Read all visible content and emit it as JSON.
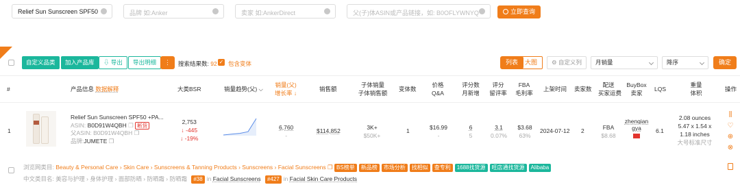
{
  "search": {
    "keyword": "Relief Sun Sunscreen SPF50",
    "brand_placeholder": "品牌 如:Anker",
    "seller_placeholder": "卖家 如:AnkerDirect",
    "asin_placeholder": "父(子)体ASIN或产品链接，如: B0OFLYWNYQ",
    "query_label": "立即查询"
  },
  "toolbar": {
    "custom_category": "自定义品类",
    "add_library": "加入产品库",
    "export": "导出",
    "export_detail": "导出明细",
    "more": "⋮",
    "result_prefix": "搜索结果数:",
    "result_count": "92",
    "include_variants": "包含变体",
    "view_list": "列表",
    "view_grid": "大图",
    "custom_columns": "自定义列",
    "sort_field": "月销量",
    "sort_order": "降序",
    "confirm": "确定"
  },
  "columns": {
    "index": "#",
    "product_info": "产品信息",
    "data_explain": "数据解释",
    "bsr": "大类BSR",
    "trend": "销量趋势(父)",
    "sales": "销量(父)",
    "growth": "增长率",
    "revenue": "销售额",
    "child_sales": "子体销量",
    "child_revenue": "子体销售额",
    "variants": "变体数",
    "price": "价格",
    "qa": "Q&A",
    "reviews": "评分数",
    "monthly_new": "月新增",
    "rating": "评分",
    "retention": "留评率",
    "fba": "FBA",
    "margin": "毛利率",
    "launch": "上架时间",
    "sellers": "卖家数",
    "delivery": "配送",
    "buybox_shipping": "买家运费",
    "buybox": "BuyBox",
    "buybox_seller": "卖家",
    "lqs": "LQS",
    "weight": "重量",
    "volume": "体积",
    "actions": "操作"
  },
  "row": {
    "index": "1",
    "title": "Relief Sun Sunscreen SPF50 +PA...",
    "asin_label": "ASIN:",
    "asin": "B0D91W4QBH",
    "badge": "断货",
    "parent_label": "父ASIN:",
    "parent_asin": "B0D91W4QBH",
    "brand_label": "品牌:",
    "brand": "JUMETE",
    "bsr": "2,753",
    "bsr_change": "↓ -445",
    "bsr_pct": "↓ -19%",
    "sales": "6,760",
    "sales_growth": "-",
    "revenue": "$114,852",
    "child_sales": "3K+",
    "child_revenue": "$50K+",
    "variants": "1",
    "price": "$16.99",
    "qa": "-",
    "reviews": "6",
    "monthly_new": "5",
    "rating": "3.1",
    "retention": "0.07%",
    "fba_fee": "$3.68",
    "margin": "63%",
    "launch": "2024-07-12",
    "sellers": "2",
    "delivery": "FBA",
    "shipping": "$8.68",
    "buybox_seller": "zhenqiangya",
    "lqs": "6.1",
    "weight": "2.08 ounces",
    "dims": "5.47 x 1.54 x 1.18 inches",
    "size_tier": "大号标准尺寸"
  },
  "trend_data": {
    "type": "line",
    "values": [
      0,
      0.05,
      0.1,
      0.2,
      1.0
    ]
  },
  "categories": {
    "label": "浏览网类目:",
    "path": [
      "Beauty & Personal Care",
      "Skin Care",
      "Sunscreens & Tanning Products",
      "Sunscreens",
      "Facial Sunscreens"
    ],
    "tags": [
      "BS榜单",
      "新品榜",
      "市场分析",
      "找相似",
      "查专利",
      "1688找货源",
      "旺店通找货源",
      "Alibaba"
    ],
    "cn_label": "中文类目名:",
    "cn_path": "美容与护理 › 身体护理 › 面部防晒 › 防晒霜 › 防晒霜",
    "rank1": "#38",
    "rank1_text": "in",
    "rank1_cat": "Facial Sunscreens",
    "rank2": "#427",
    "rank2_text": "in",
    "rank2_cat": "Facial Skin Care Products"
  },
  "colors": {
    "accent": "#f07d1a",
    "teal": "#1bb79c",
    "red": "#e2342d"
  }
}
